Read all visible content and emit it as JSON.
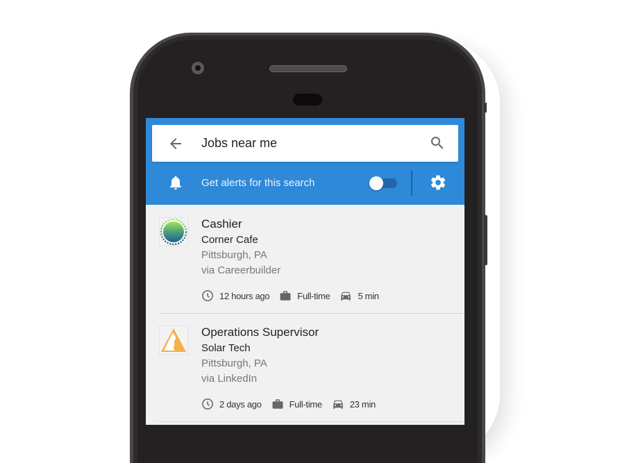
{
  "search": {
    "query": "Jobs near me",
    "back_icon": "arrow-back-icon",
    "search_icon": "magnifier-icon"
  },
  "alerts": {
    "label": "Get alerts for this search",
    "toggle_on": false,
    "bell_icon": "bell-icon",
    "settings_icon": "gear-icon"
  },
  "colors": {
    "appbar": "#2e89d8",
    "list_background": "#f1f1f1",
    "phone_body": "#242122"
  },
  "jobs": [
    {
      "title": "Cashier",
      "company": "Corner Cafe",
      "location": "Pittsburgh, PA",
      "source": "via Careerbuilder",
      "posted": "12 hours ago",
      "type": "Full-time",
      "commute": "5 min",
      "logo": "green-sun-badge-logo"
    },
    {
      "title": "Operations Supervisor",
      "company": "Solar Tech",
      "location": "Pittsburgh, PA",
      "source": "via LinkedIn",
      "posted": "2 days ago",
      "type": "Full-time",
      "commute": "23 min",
      "logo": "orange-triangle-logo"
    }
  ]
}
